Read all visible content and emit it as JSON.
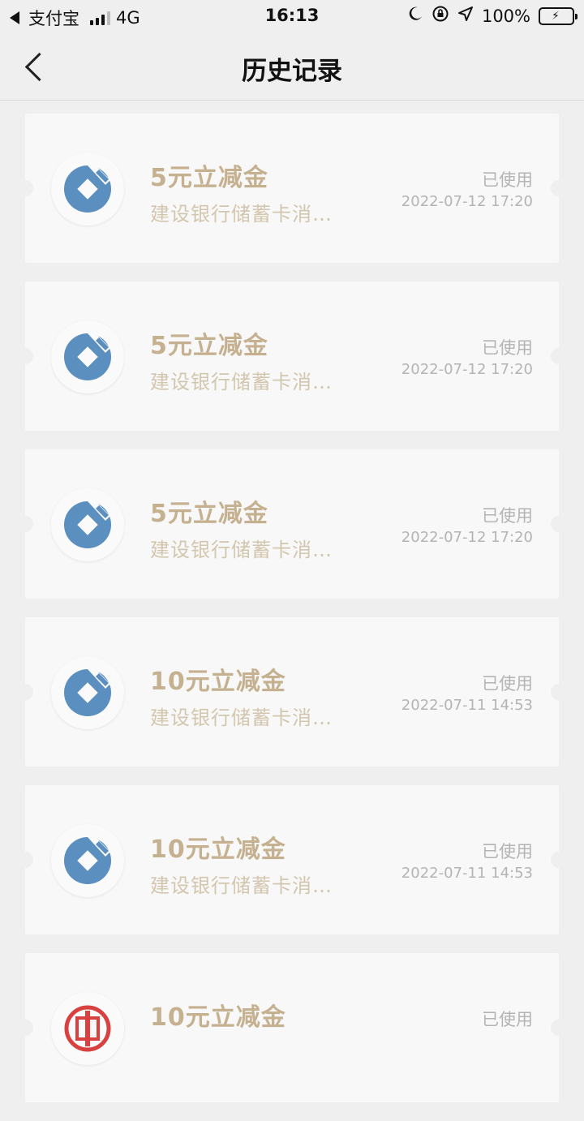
{
  "status_bar": {
    "app": "支付宝",
    "network": "4G",
    "time": "16:13",
    "battery": "100%"
  },
  "nav": {
    "title": "历史记录"
  },
  "records": [
    {
      "title": "5元立减金",
      "desc": "建设银行储蓄卡消…",
      "status": "已使用",
      "time": "2022-07-12 17:20",
      "bank": "ccb"
    },
    {
      "title": "5元立减金",
      "desc": "建设银行储蓄卡消…",
      "status": "已使用",
      "time": "2022-07-12 17:20",
      "bank": "ccb"
    },
    {
      "title": "5元立减金",
      "desc": "建设银行储蓄卡消…",
      "status": "已使用",
      "time": "2022-07-12 17:20",
      "bank": "ccb"
    },
    {
      "title": "10元立减金",
      "desc": "建设银行储蓄卡消…",
      "status": "已使用",
      "time": "2022-07-11 14:53",
      "bank": "ccb"
    },
    {
      "title": "10元立减金",
      "desc": "建设银行储蓄卡消…",
      "status": "已使用",
      "time": "2022-07-11 14:53",
      "bank": "ccb"
    },
    {
      "title": "10元立减金",
      "desc": "",
      "status": "已使用",
      "time": "",
      "bank": "icbc"
    }
  ],
  "colors": {
    "ccb_blue": "#5b8fbf",
    "icbc_red": "#d8413f"
  }
}
